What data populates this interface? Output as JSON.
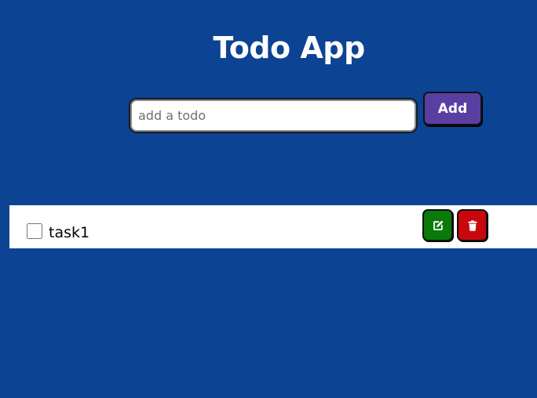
{
  "app": {
    "title": "Todo App"
  },
  "form": {
    "placeholder": "add a todo",
    "value": "",
    "add_label": "Add"
  },
  "todos": [
    {
      "text": "task1",
      "completed": false,
      "edit_icon": "edit-icon",
      "delete_icon": "trash-icon"
    }
  ],
  "colors": {
    "background": "#0c4393",
    "add_button": "#5a3fa3",
    "edit_button": "#0a7a0a",
    "delete_button": "#c8080c"
  }
}
